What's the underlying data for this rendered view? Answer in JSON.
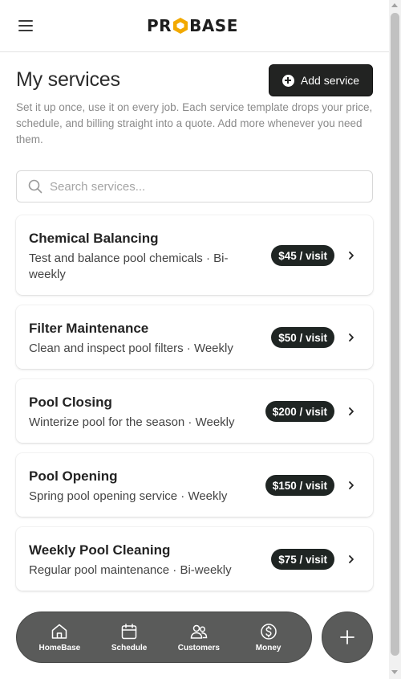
{
  "app": {
    "logo_text_left": "PR",
    "logo_text_right": "BASE"
  },
  "page": {
    "title": "My services",
    "add_button_label": "Add service",
    "intro": "Set it up once, use it on every job. Each service template drops your price, schedule, and billing straight into a quote. Add more whenever you need them."
  },
  "search": {
    "placeholder": "Search services..."
  },
  "services": [
    {
      "name": "Chemical Balancing",
      "description": "Test and balance pool chemicals · Bi-weekly",
      "price": "$45 / visit"
    },
    {
      "name": "Filter Maintenance",
      "description": "Clean and inspect pool filters · Weekly",
      "price": "$50 / visit"
    },
    {
      "name": "Pool Closing",
      "description": "Winterize pool for the season · Weekly",
      "price": "$200 / visit"
    },
    {
      "name": "Pool Opening",
      "description": "Spring pool opening service · Weekly",
      "price": "$150 / visit"
    },
    {
      "name": "Weekly Pool Cleaning",
      "description": "Regular pool maintenance · Bi-weekly",
      "price": "$75 / visit"
    }
  ],
  "nav": [
    {
      "label": "HomeBase",
      "icon": "home-icon"
    },
    {
      "label": "Schedule",
      "icon": "calendar-icon"
    },
    {
      "label": "Customers",
      "icon": "users-icon"
    },
    {
      "label": "Money",
      "icon": "dollar-icon"
    }
  ],
  "colors": {
    "primary_dark": "#222322",
    "nav_bg": "#5a5b5a",
    "logo_accent": "#f2a900"
  }
}
